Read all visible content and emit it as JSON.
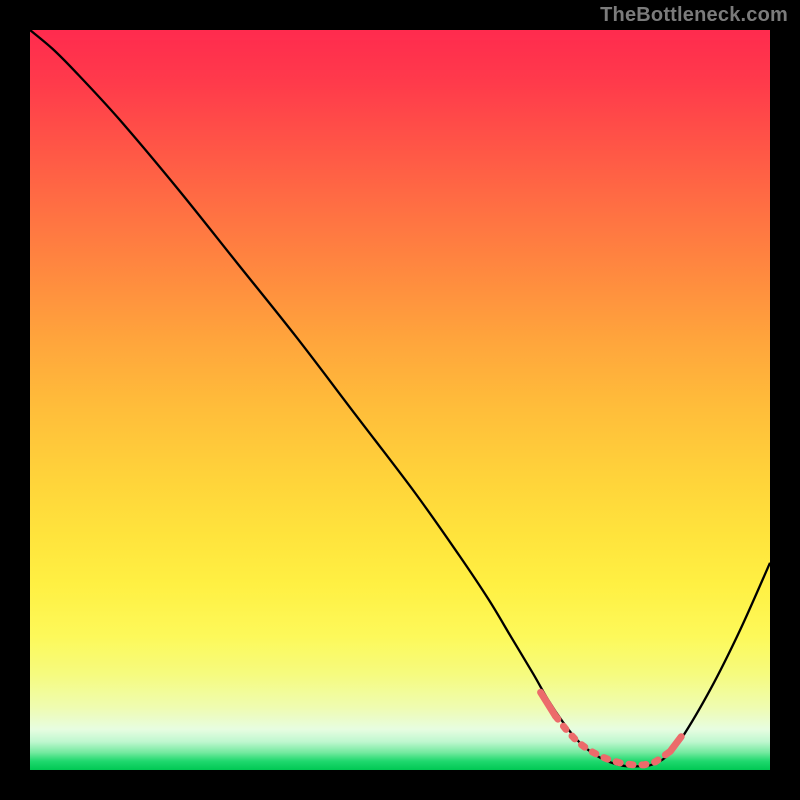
{
  "watermark": {
    "text": "TheBottleneck.com"
  },
  "chart_data": {
    "type": "line",
    "title": "",
    "xlabel": "",
    "ylabel": "",
    "xlim": [
      0,
      100
    ],
    "ylim": [
      0,
      100
    ],
    "grid": false,
    "legend": false,
    "series": [
      {
        "name": "bottleneck-curve",
        "color": "#000000",
        "x": [
          0,
          3,
          6,
          12,
          20,
          28,
          36,
          44,
          52,
          58,
          62,
          65,
          68,
          70,
          72,
          74,
          76,
          78,
          80,
          82,
          84,
          86,
          88,
          92,
          96,
          100
        ],
        "y": [
          100,
          97.5,
          94.5,
          88,
          78.5,
          68.5,
          58.5,
          48,
          37.5,
          29,
          23,
          18,
          13,
          9.5,
          6.5,
          4,
          2.3,
          1.2,
          0.6,
          0.5,
          0.7,
          1.8,
          4.2,
          11,
          19,
          28
        ]
      }
    ],
    "markers": {
      "name": "highlight-dots",
      "color": "#ec6b6b",
      "x": [
        69,
        71,
        72.5,
        74,
        75.5,
        77,
        78.5,
        80,
        81.5,
        83,
        84.5,
        86.5,
        88
      ],
      "y": [
        10.5,
        7.3,
        5.4,
        3.8,
        2.7,
        1.9,
        1.3,
        0.9,
        0.7,
        0.7,
        1.1,
        2.5,
        4.5
      ]
    },
    "background_gradient": {
      "orientation": "vertical",
      "stops": [
        {
          "pos": 0.0,
          "color": "#ff2b4e"
        },
        {
          "pos": 0.25,
          "color": "#ff7a41"
        },
        {
          "pos": 0.5,
          "color": "#ffc63b"
        },
        {
          "pos": 0.75,
          "color": "#fff647"
        },
        {
          "pos": 0.93,
          "color": "#e9fdcf"
        },
        {
          "pos": 1.0,
          "color": "#00c853"
        }
      ]
    }
  }
}
